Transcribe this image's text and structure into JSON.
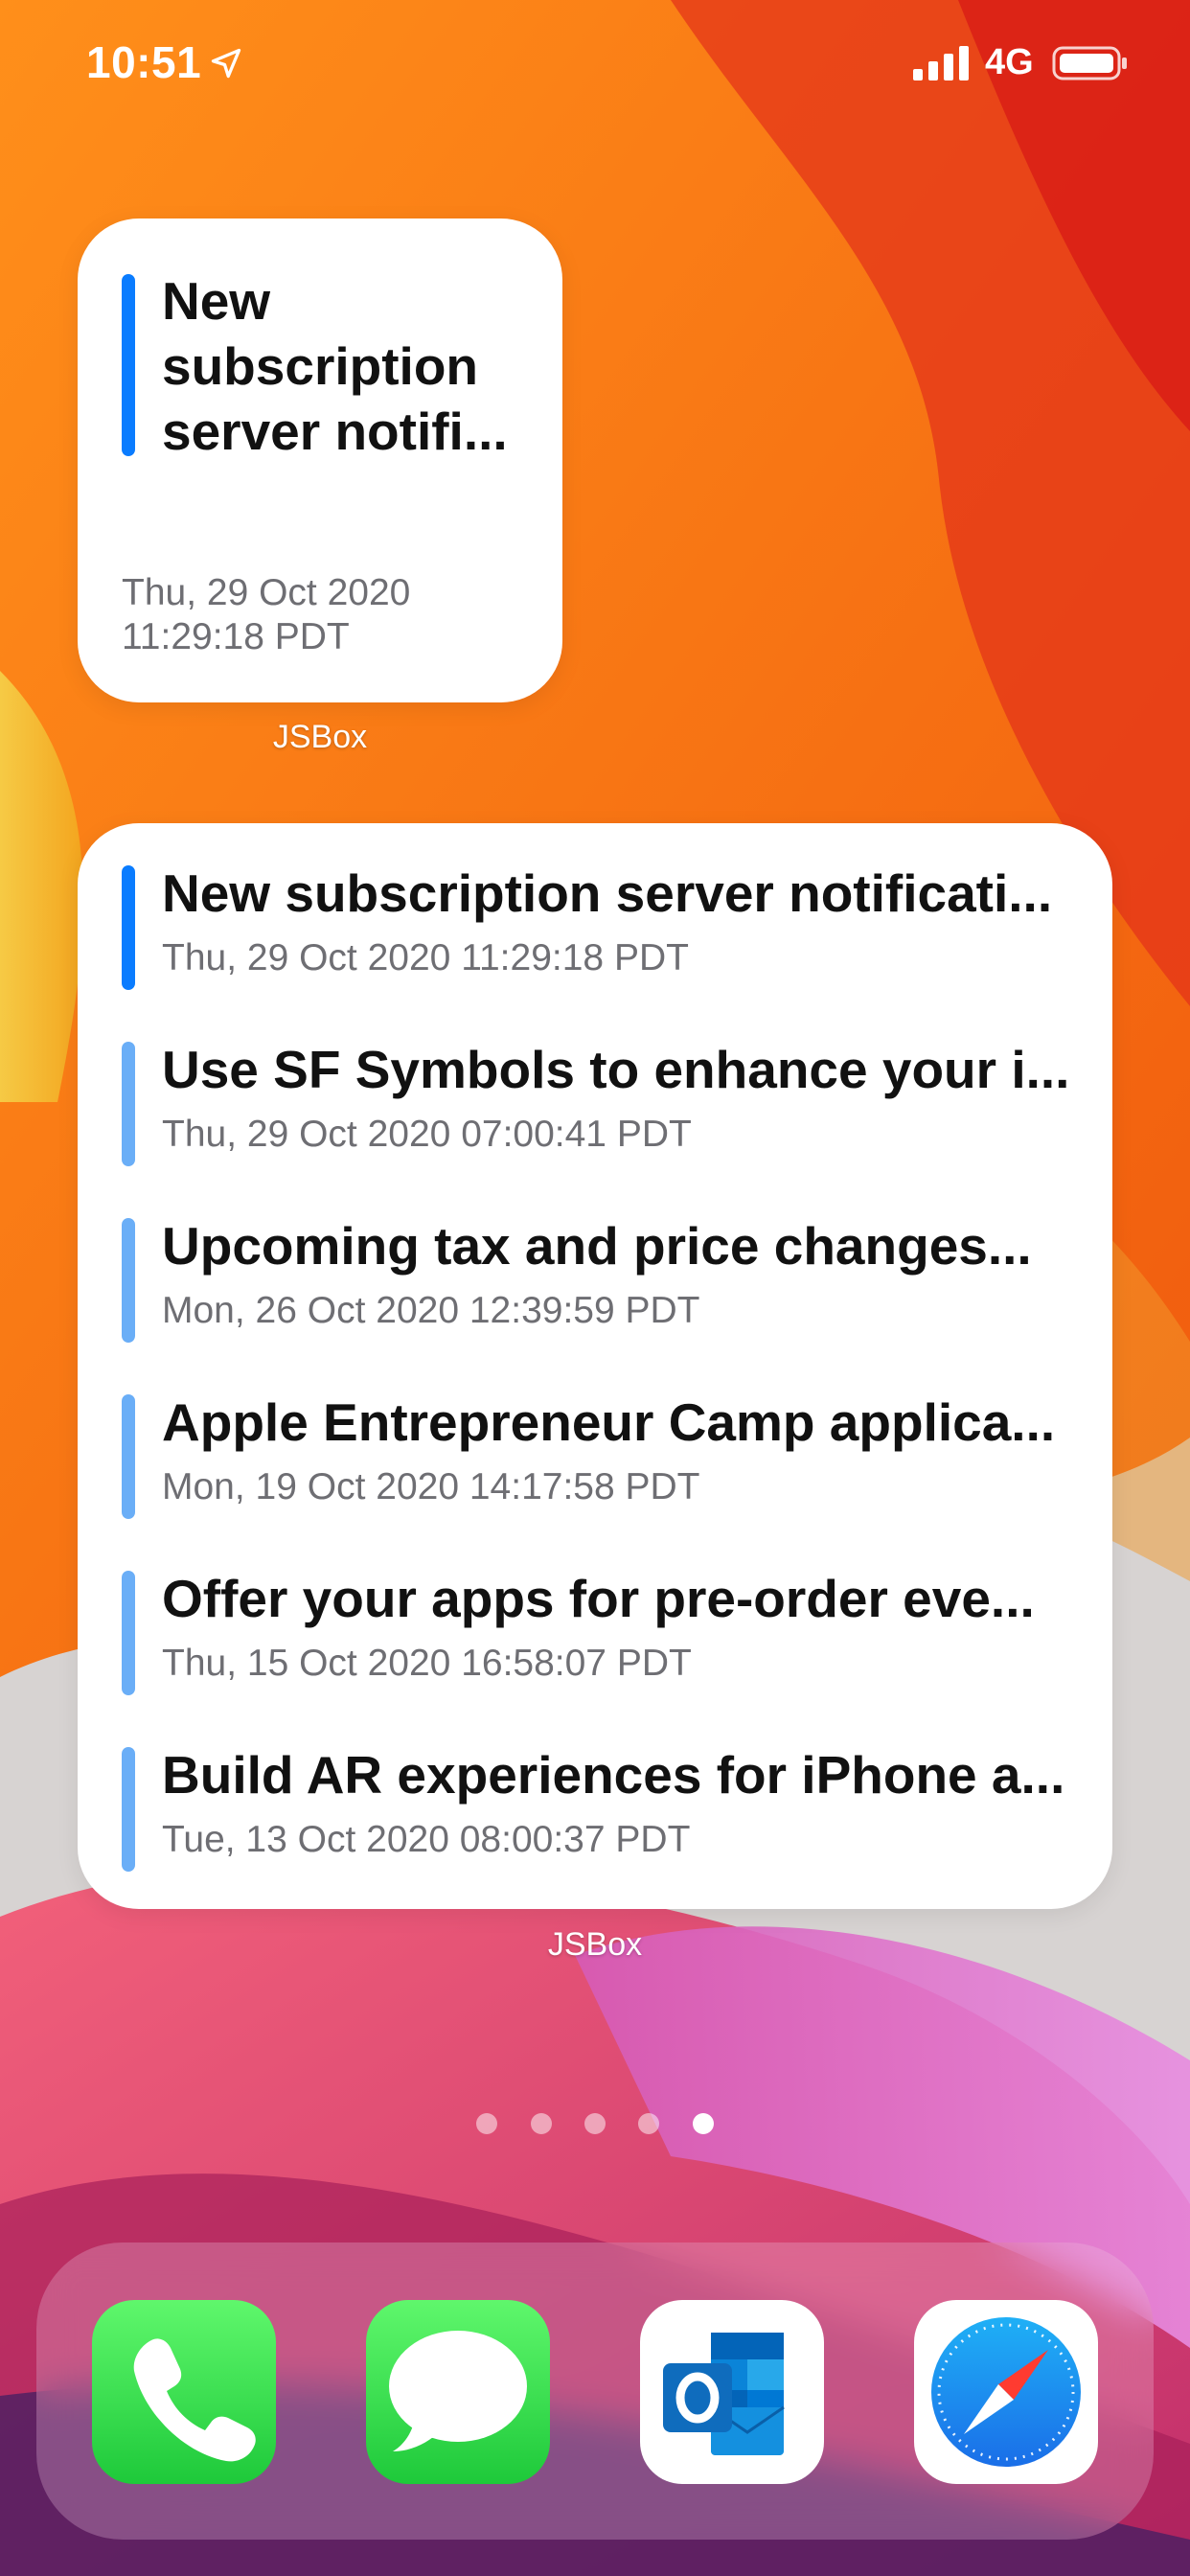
{
  "status_bar": {
    "time": "10:51",
    "network": "4G",
    "icons": [
      "location-icon",
      "signal-icon",
      "battery-icon"
    ]
  },
  "small_widget": {
    "title": "New subscription server notifi...",
    "date_line1": "Thu, 29 Oct 2020",
    "date_line2": "11:29:18 PDT",
    "label": "JSBox"
  },
  "large_widget": {
    "label": "JSBox",
    "items": [
      {
        "title": "New subscription server notificati...",
        "date": "Thu, 29 Oct 2020 11:29:18 PDT"
      },
      {
        "title": "Use SF Symbols to enhance your i...",
        "date": "Thu, 29 Oct 2020 07:00:41 PDT"
      },
      {
        "title": "Upcoming tax and price changes...",
        "date": "Mon, 26 Oct 2020 12:39:59 PDT"
      },
      {
        "title": "Apple Entrepreneur Camp applica...",
        "date": "Mon, 19 Oct 2020 14:17:58 PDT"
      },
      {
        "title": "Offer your apps for pre-order eve...",
        "date": "Thu, 15 Oct 2020 16:58:07 PDT"
      },
      {
        "title": "Build AR experiences for iPhone a...",
        "date": "Tue, 13 Oct 2020 08:00:37 PDT"
      }
    ]
  },
  "page_indicator": {
    "total": 5,
    "current": 5
  },
  "dock": {
    "apps": [
      {
        "name": "Phone",
        "icon": "phone-icon"
      },
      {
        "name": "Messages",
        "icon": "messages-icon"
      },
      {
        "name": "Outlook",
        "icon": "outlook-icon"
      },
      {
        "name": "Safari",
        "icon": "safari-icon"
      }
    ]
  },
  "colors": {
    "accent_latest": "#0a7cff",
    "accent_older": "#6aaef7",
    "wallpaper_orange": "#f7740d",
    "wallpaper_pink": "#e0457a"
  }
}
